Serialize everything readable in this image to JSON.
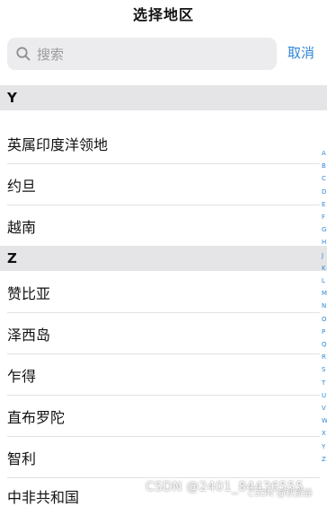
{
  "header": {
    "title": "选择地区"
  },
  "search": {
    "placeholder": "搜索",
    "cancel_label": "取消"
  },
  "sections": [
    {
      "letter": "Y",
      "items": [
        "英属印度洋领地",
        "约旦",
        "越南"
      ]
    },
    {
      "letter": "Z",
      "items": [
        "赞比亚",
        "泽西岛",
        "乍得",
        "直布罗陀",
        "智利",
        "中非共和国"
      ]
    }
  ],
  "index_letters": [
    "A",
    "B",
    "C",
    "D",
    "E",
    "F",
    "G",
    "H",
    "J",
    "K",
    "L",
    "M",
    "N",
    "O",
    "P",
    "Q",
    "R",
    "S",
    "T",
    "U",
    "V",
    "W",
    "X",
    "Y",
    "Z"
  ],
  "watermark": {
    "main": "CSDN @2401_84436555",
    "secondary": "CSDN @秋旅蜂"
  },
  "colors": {
    "accent": "#2f86d8",
    "section_bg": "#e5e5e7",
    "search_bg": "#ececee"
  }
}
